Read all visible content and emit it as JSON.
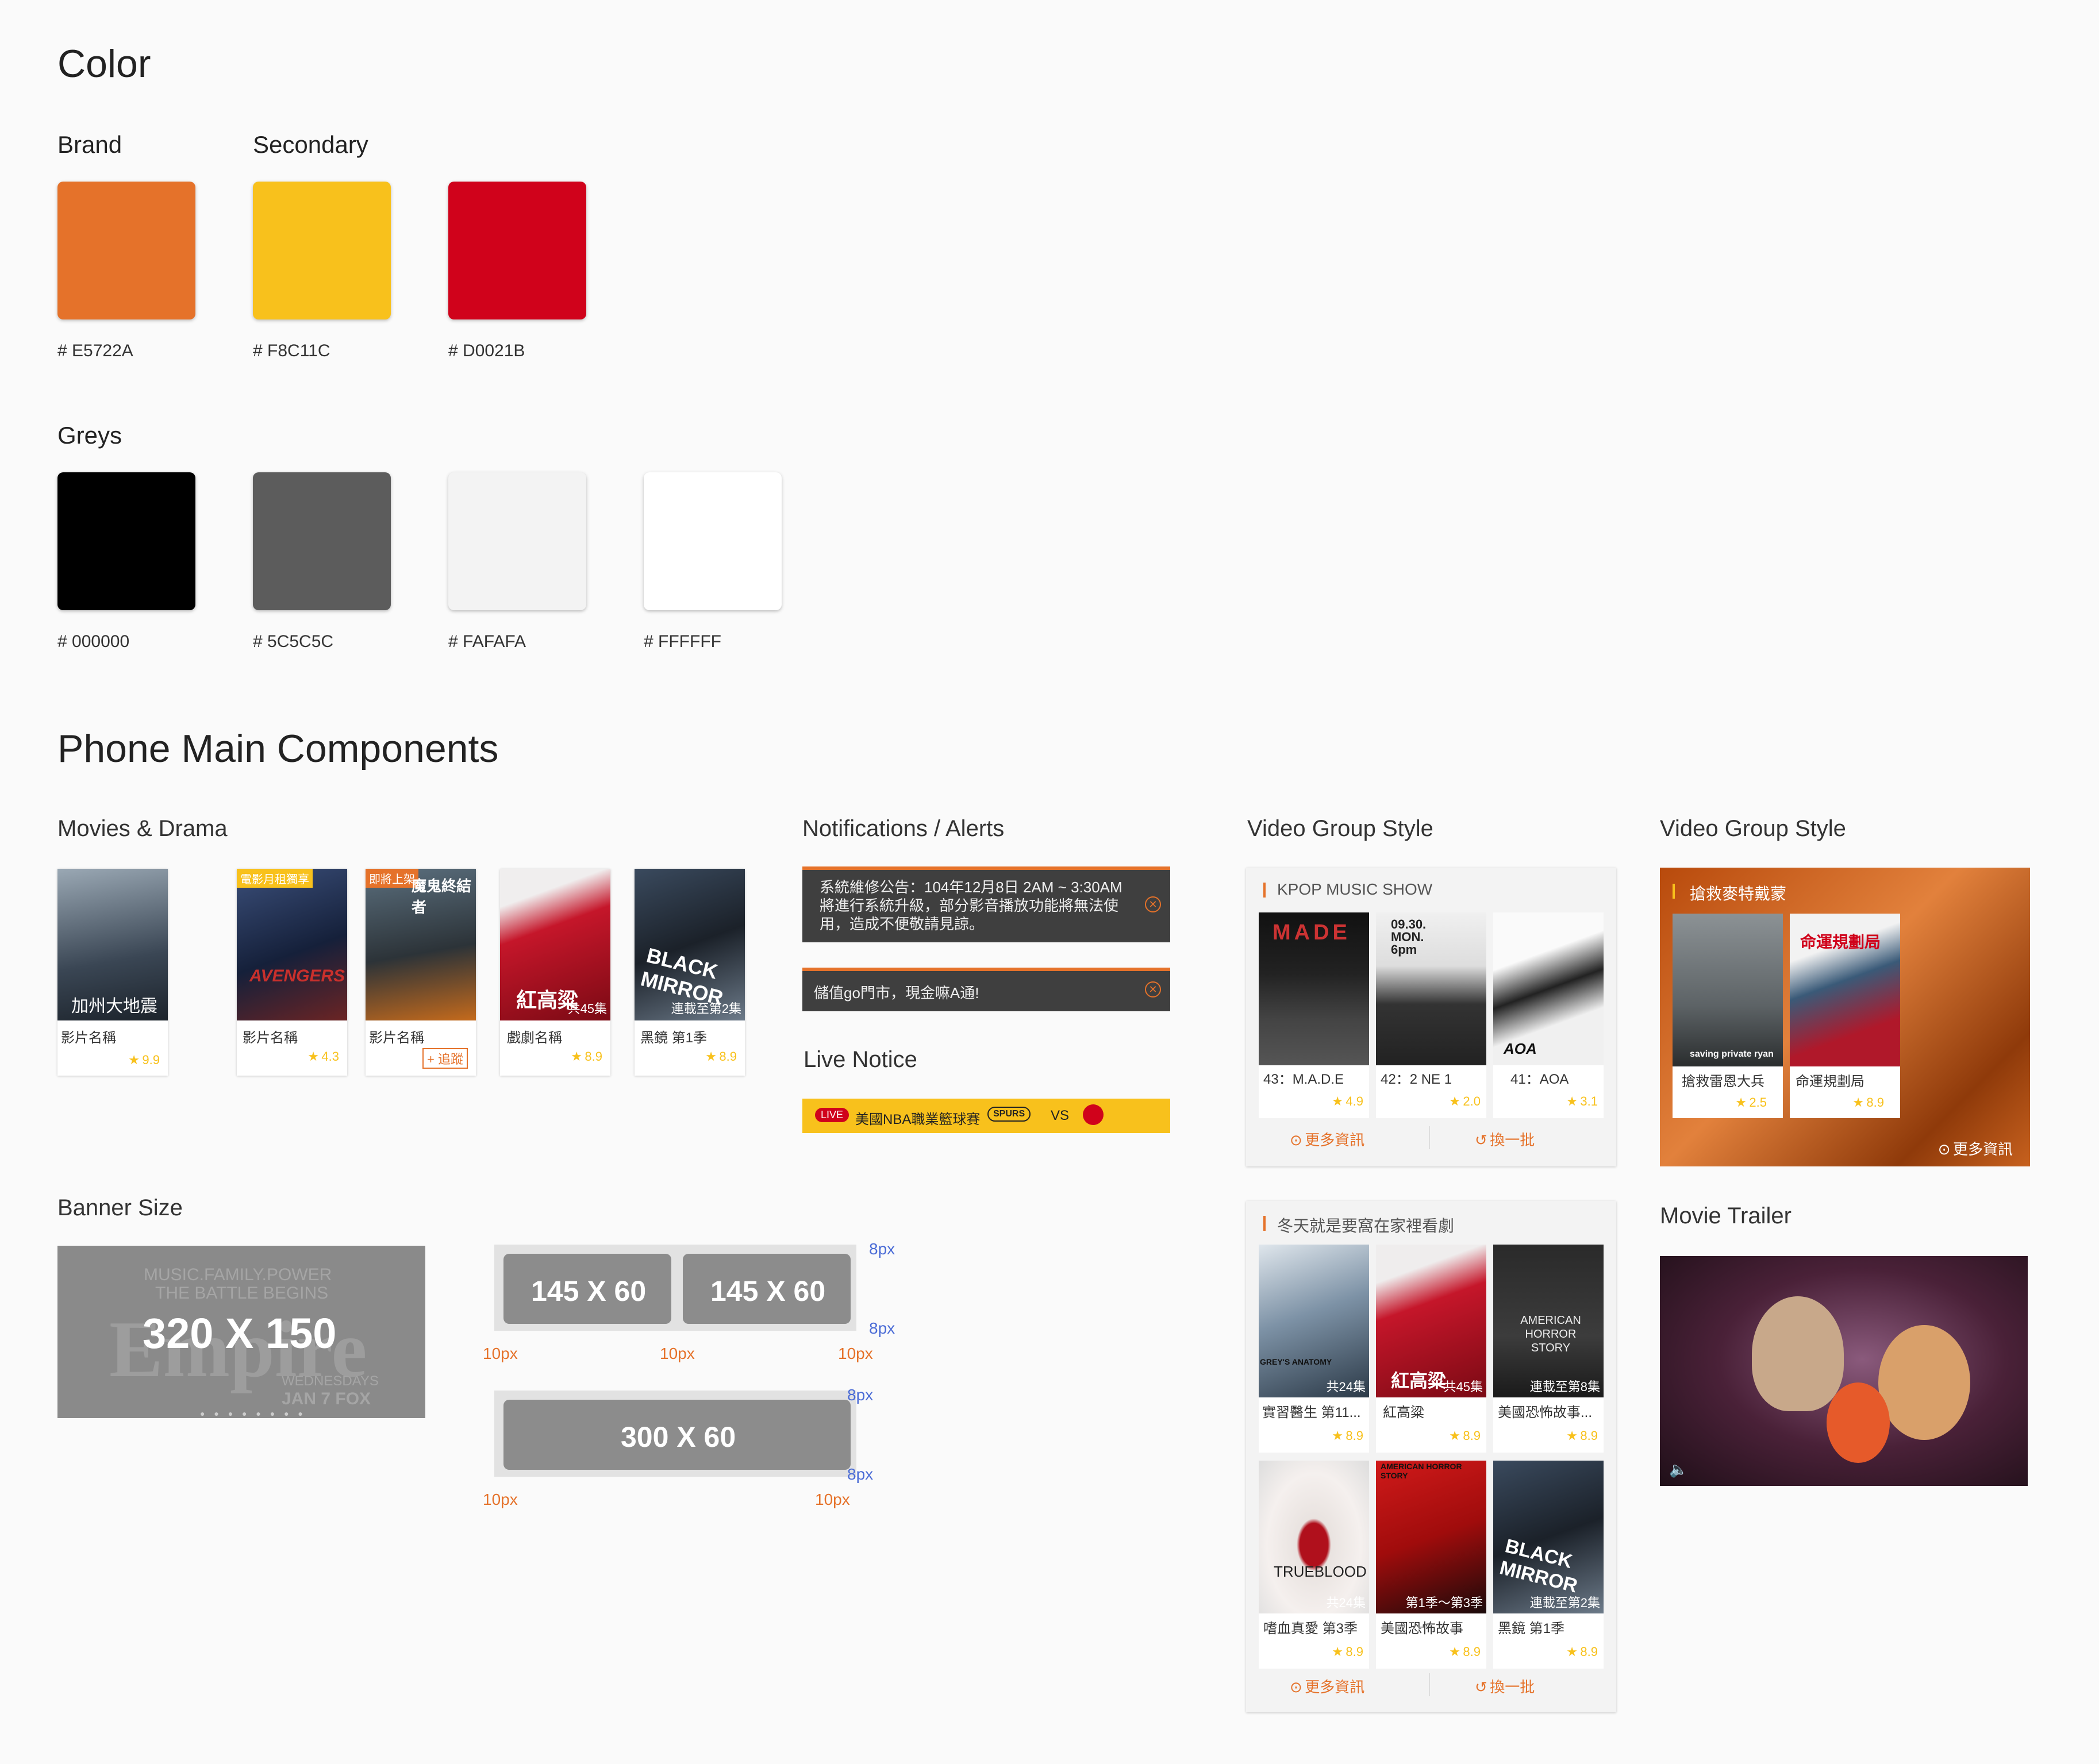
{
  "color": {
    "title": "Color",
    "brand_label": "Brand",
    "secondary_label": "Secondary",
    "brand": [
      {
        "hex_label": "# E5722A",
        "color": "#E5722A"
      }
    ],
    "secondary": [
      {
        "hex_label": "# F8C11C",
        "color": "#F8C11C"
      },
      {
        "hex_label": "# D0021B",
        "color": "#D0021B"
      }
    ],
    "greys_label": "Greys",
    "greys": [
      {
        "hex_label": "# 000000",
        "color": "#000000"
      },
      {
        "hex_label": "# 5C5C5C",
        "color": "#5C5C5C"
      },
      {
        "hex_label": "# FAFAFA",
        "color": "#FAFAFA"
      },
      {
        "hex_label": "# FFFFFF",
        "color": "#FFFFFF"
      }
    ]
  },
  "components": {
    "title": "Phone Main Components",
    "movies": {
      "label": "Movies & Drama",
      "items": [
        {
          "poster_text": "加州大地震",
          "name": "影片名稱",
          "rating": "9.9"
        },
        {
          "tag": "電影月租獨享",
          "name": "影片名稱",
          "rating": "4.3"
        },
        {
          "tag": "即將上架",
          "poster_text": "魔鬼終結者",
          "name": "影片名稱",
          "follow": "+ 追蹤"
        },
        {
          "poster_text": "紅高粱",
          "episodes": "共45集",
          "name": "戲劇名稱",
          "rating": "8.9"
        },
        {
          "poster_text": "BLACK MIRROR",
          "episodes": "連載至第2集",
          "name": "黑鏡 第1季",
          "rating": "8.9"
        }
      ]
    },
    "notifications": {
      "label": "Notifications / Alerts",
      "alert1": "系統維修公告：104年12月8日 2AM ~ 3:30AM將進行系統升級，部分影音播放功能將無法使用，造成不便敬請見諒。",
      "alert2": "儲值go門市，現金嘛A通!"
    },
    "live": {
      "label": "Live Notice",
      "badge": "LIVE",
      "text": "美國NBA職業籃球賽",
      "team": "SPURS",
      "vs": "VS"
    },
    "banner": {
      "label": "Banner Size",
      "big": "320 X 150",
      "big_bg_line1": "MUSIC.FAMILY.POWER",
      "big_bg_line2": "THE BATTLE BEGINS",
      "big_bg_logo": "Empire",
      "big_bg_line3": "WEDNESDAYS",
      "big_bg_line4": "JAN 7 FOX",
      "small1": "145 X 60",
      "small2": "145 X 60",
      "wide": "300 X 60",
      "px8": "8px",
      "px10": "10px"
    },
    "group1": {
      "label": "Video Group Style",
      "title": "KPOP MUSIC SHOW",
      "items": [
        {
          "poster_text": "MADE",
          "name": "43：M.A.D.E",
          "rating": "4.9"
        },
        {
          "poster_text": "09.30. MON. 6pm",
          "name": "42：2 NE 1",
          "rating": "2.0"
        },
        {
          "poster_text": "AOA",
          "name": "41：AOA",
          "rating": "3.1"
        }
      ],
      "more": "更多資訊",
      "refresh": "換一批"
    },
    "group2": {
      "label": "Video Group Style",
      "title": "搶救麥特戴蒙",
      "items": [
        {
          "poster_text": "saving private ryan",
          "name": "搶救雷恩大兵",
          "rating": "2.5"
        },
        {
          "poster_text": "命運規劃局",
          "name": "命運規劃局",
          "rating": "8.9"
        }
      ],
      "more": "更多資訊"
    },
    "group3": {
      "title": "冬天就是要窩在家裡看劇",
      "items": [
        {
          "poster_text": "GREY'S ANATOMY",
          "episodes": "共24集",
          "name": "實習醫生 第11...",
          "rating": "8.9"
        },
        {
          "poster_text": "紅高粱",
          "episodes": "共45集",
          "name": "紅高粱",
          "rating": "8.9"
        },
        {
          "poster_text": "AMERICAN HORROR STORY",
          "episodes": "連載至第8集",
          "name": "美國恐怖故事...",
          "rating": "8.9"
        },
        {
          "poster_text": "TRUEBLOOD",
          "episodes": "共24集",
          "name": "嗜血真愛 第3季",
          "rating": "8.9"
        },
        {
          "poster_text": "AMERICAN HORROR STORY",
          "episodes": "第1季～第3季",
          "name": "美國恐怖故事",
          "rating": "8.9"
        },
        {
          "poster_text": "BLACK MIRROR",
          "episodes": "連載至第2集",
          "name": "黑鏡 第1季",
          "rating": "8.9"
        }
      ],
      "more": "更多資訊",
      "refresh": "換一批"
    },
    "trailer": {
      "label": "Movie Trailer"
    }
  }
}
